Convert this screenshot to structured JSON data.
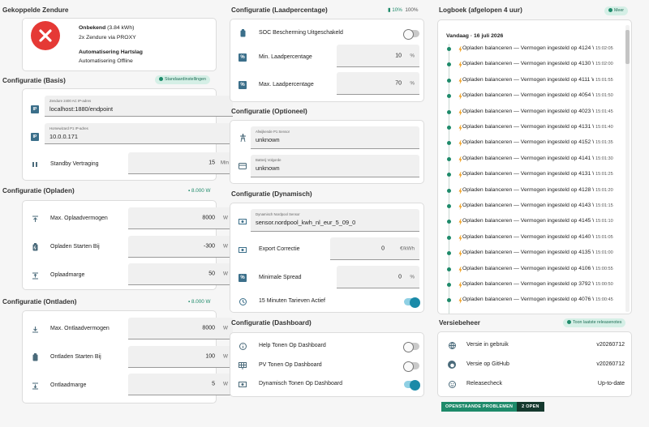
{
  "col1": {
    "zendure_title": "Gekoppelde Zendure",
    "device": {
      "status_bold": "Onbekend",
      "status_rest": " (3.84 kWh)",
      "proxy": "2x Zendure via PROXY",
      "automation_bold": "Automatisering Hartslag",
      "automation_rest": "Automatisering Offline"
    },
    "basis": {
      "title": "Configuratie (Basis)",
      "badge": "Standaardinstellingen",
      "ip1_label": "Zendure 2400 AC IP-adres",
      "ip1_value": "localhost:1880/endpoint",
      "ip2_label": "Homewizard P1 IP-adres",
      "ip2_value": "10.0.0.171",
      "standby_label": "Standby Vertraging",
      "standby_value": "15",
      "standby_unit": "Min"
    },
    "opladen": {
      "title": "Configuratie (Opladen)",
      "hint": "8.000 W",
      "rows": [
        {
          "label": "Max. Oplaadvermogen",
          "value": "8000",
          "unit": "W"
        },
        {
          "label": "Opladen Starten Bij",
          "value": "-300",
          "unit": "W"
        },
        {
          "label": "Oplaadmarge",
          "value": "50",
          "unit": "W"
        }
      ]
    },
    "ontladen": {
      "title": "Configuratie (Ontladen)",
      "hint": "8.000 W",
      "rows": [
        {
          "label": "Max. Ontlaadvermogen",
          "value": "8000",
          "unit": "W"
        },
        {
          "label": "Ontladen Starten Bij",
          "value": "100",
          "unit": "W"
        },
        {
          "label": "Ontlaadmarge",
          "value": "5",
          "unit": "W"
        }
      ]
    }
  },
  "col2": {
    "laad": {
      "title": "Configuratie (Laadpercentage)",
      "hint_green": "10%",
      "hint_gray": "100%",
      "soc_label": "SOC Bescherming Uitgeschakeld",
      "soc_on": false,
      "min_label": "Min. Laadpercentage",
      "min_value": "10",
      "min_unit": "%",
      "max_label": "Max. Laadpercentage",
      "max_value": "70",
      "max_unit": "%"
    },
    "optioneel": {
      "title": "Configuratie (Optioneel)",
      "sensor_label": "Afwijkende P1 Sensor",
      "sensor_value": "unknown",
      "battery_label": "Batterij Volgorde",
      "battery_value": "unknown"
    },
    "dynamisch": {
      "title": "Configuratie (Dynamisch)",
      "nordpool_label": "Dynamisch Nordpool Sensor",
      "nordpool_value": "sensor.nordpool_kwh_nl_eur_5_09_0",
      "export_label": "Export Correctie",
      "export_value": "0",
      "export_unit": "€/kWh",
      "spread_label": "Minimale Spread",
      "spread_value": "0",
      "spread_unit": "%",
      "tarief_label": "15 Minuten Tarieven Actief",
      "tarief_on": true
    },
    "dashboard": {
      "title": "Configuratie (Dashboard)",
      "rows": [
        {
          "label": "Help Tonen Op Dashboard",
          "on": false
        },
        {
          "label": "PV Tonen Op Dashboard",
          "on": false
        },
        {
          "label": "Dynamisch Tonen Op Dashboard",
          "on": true
        }
      ]
    }
  },
  "col3": {
    "log": {
      "title": "Logboek (afgelopen 4 uur)",
      "badge": "Meer",
      "date": "Vandaag · 16 juli 2026",
      "items": [
        {
          "text": "Opladen balanceren — Vermogen ingesteld op 4124 W",
          "time": "15:02:05"
        },
        {
          "text": "Opladen balanceren — Vermogen ingesteld op 4130 W",
          "time": "15:02:00"
        },
        {
          "text": "Opladen balanceren — Vermogen ingesteld op 4111 W",
          "time": "15:01:55"
        },
        {
          "text": "Opladen balanceren — Vermogen ingesteld op 4054 W",
          "time": "15:01:50"
        },
        {
          "text": "Opladen balanceren — Vermogen ingesteld op 4023 W",
          "time": "15:01:45"
        },
        {
          "text": "Opladen balanceren — Vermogen ingesteld op 4131 W",
          "time": "15:01:40"
        },
        {
          "text": "Opladen balanceren — Vermogen ingesteld op 4152 W",
          "time": "15:01:35"
        },
        {
          "text": "Opladen balanceren — Vermogen ingesteld op 4141 W",
          "time": "15:01:30"
        },
        {
          "text": "Opladen balanceren — Vermogen ingesteld op 4131 W",
          "time": "15:01:25"
        },
        {
          "text": "Opladen balanceren — Vermogen ingesteld op 4128 W",
          "time": "15:01:20"
        },
        {
          "text": "Opladen balanceren — Vermogen ingesteld op 4143 W",
          "time": "15:01:15"
        },
        {
          "text": "Opladen balanceren — Vermogen ingesteld op 4145 W",
          "time": "15:01:10"
        },
        {
          "text": "Opladen balanceren — Vermogen ingesteld op 4140 W",
          "time": "15:01:05"
        },
        {
          "text": "Opladen balanceren — Vermogen ingesteld op 4135 W",
          "time": "15:01:00"
        },
        {
          "text": "Opladen balanceren — Vermogen ingesteld op 4106 W",
          "time": "15:00:55"
        },
        {
          "text": "Opladen balanceren — Vermogen ingesteld op 3792 W",
          "time": "15:00:50"
        },
        {
          "text": "Opladen balanceren — Vermogen ingesteld op 4076 W",
          "time": "15:00:45"
        }
      ]
    },
    "versie": {
      "title": "Versiebeheer",
      "badge": "Toon laatste releasenotes",
      "rows": [
        {
          "label": "Versie in gebruik",
          "value": "v20260712"
        },
        {
          "label": "Versie op GitHub",
          "value": "v20260712"
        },
        {
          "label": "Releasecheck",
          "value": "Up-to-date"
        }
      ]
    },
    "problems": {
      "label": "OPENSTAANDE PROBLEMEN",
      "count": "2 OPEN"
    }
  },
  "colors": {
    "accent": "#1e8a6a",
    "error": "#e53935",
    "toggle": "#1a8aa8"
  }
}
